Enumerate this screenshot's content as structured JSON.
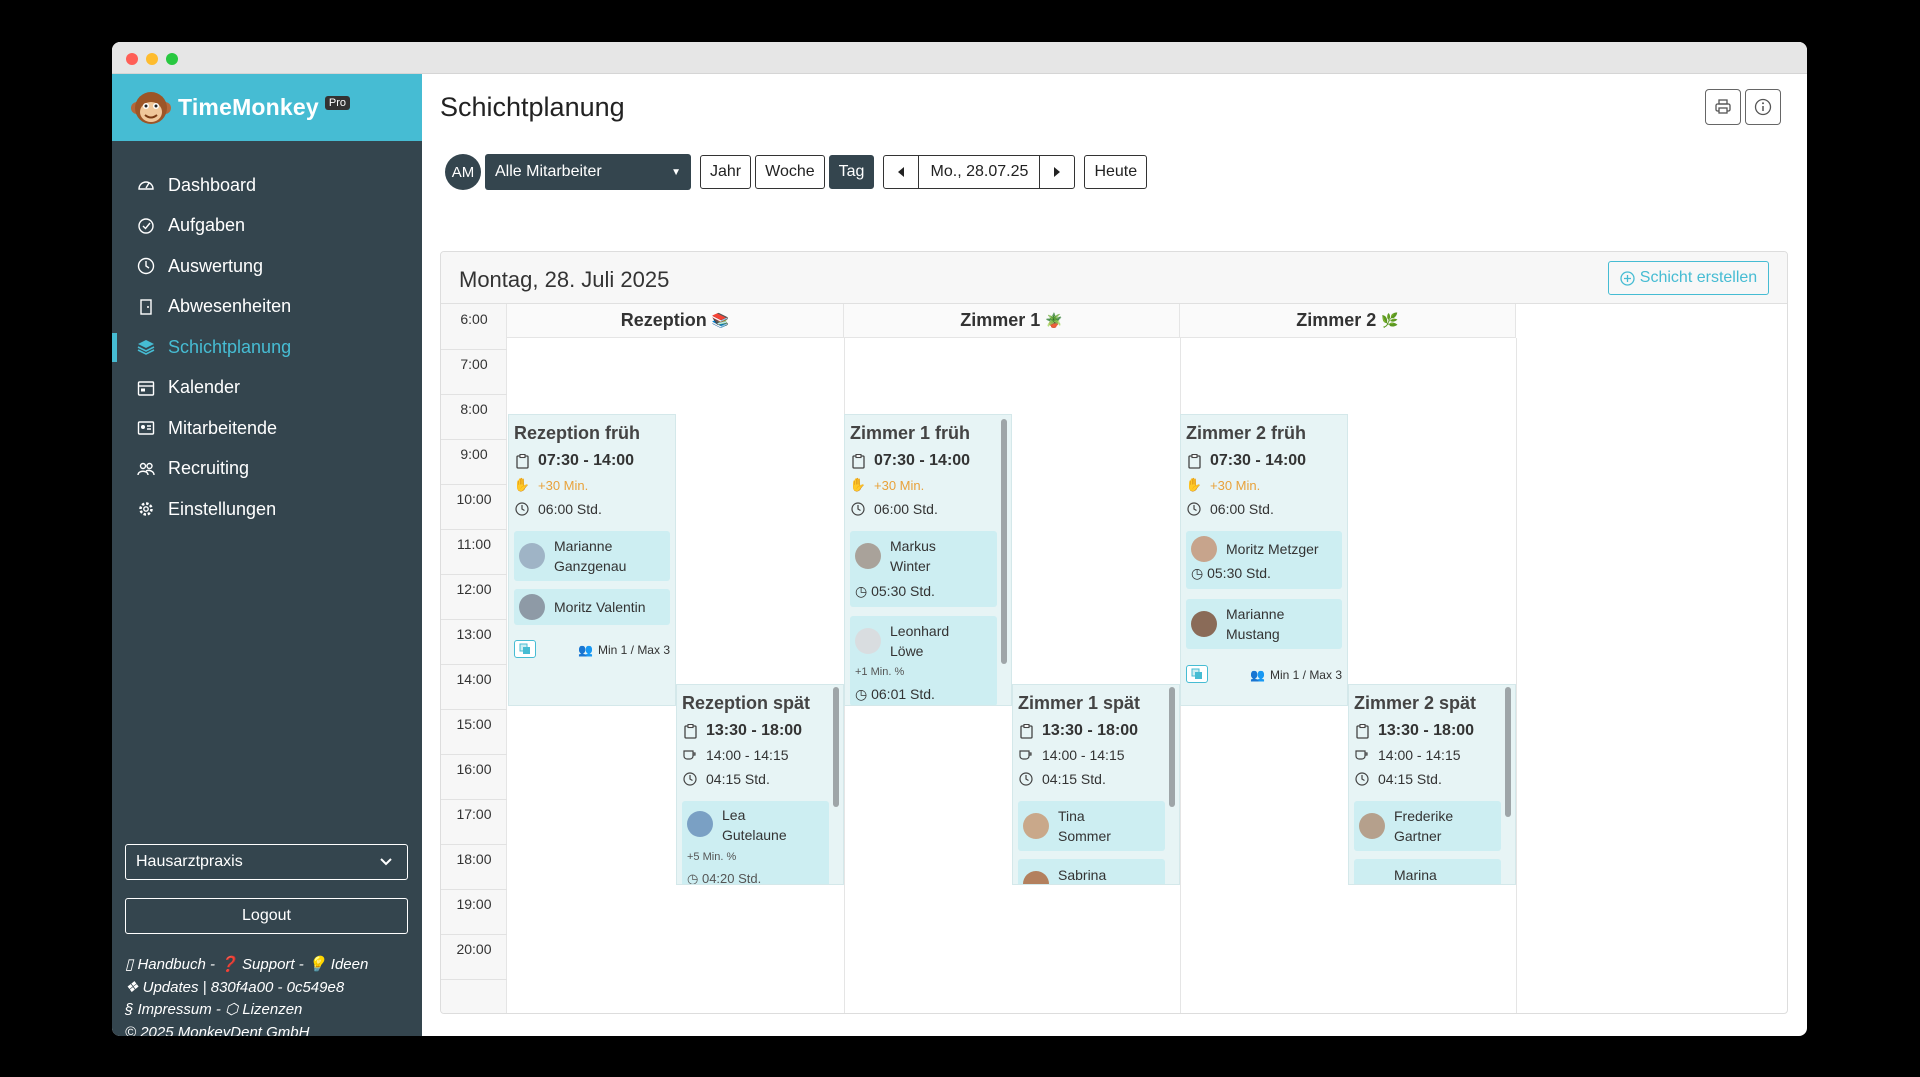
{
  "brand": {
    "name": "TimeMonkey",
    "badge": "Pro"
  },
  "nav": [
    {
      "label": "Dashboard",
      "icon": "dashboard-icon"
    },
    {
      "label": "Aufgaben",
      "icon": "check-circle-icon"
    },
    {
      "label": "Auswertung",
      "icon": "clock-icon"
    },
    {
      "label": "Abwesenheiten",
      "icon": "door-icon"
    },
    {
      "label": "Schichtplanung",
      "icon": "layers-icon",
      "active": true
    },
    {
      "label": "Kalender",
      "icon": "calendar-icon"
    },
    {
      "label": "Mitarbeitende",
      "icon": "id-card-icon"
    },
    {
      "label": "Recruiting",
      "icon": "people-icon"
    },
    {
      "label": "Einstellungen",
      "icon": "gear-icon"
    }
  ],
  "sidebar": {
    "org": "Hausarztpraxis",
    "logout": "Logout",
    "footer": {
      "handbook": "Handbuch",
      "support": "Support",
      "ideas": "Ideen",
      "updates": "Updates | 830f4a00 - 0c549e8",
      "impressum": "§ Impressum",
      "licenses": "Lizenzen",
      "copyright": "© 2025 MonkeyDent GmbH"
    }
  },
  "page": {
    "title": "Schichtplanung",
    "avatar": "AM",
    "employee_select": "Alle Mitarbeiter",
    "views": [
      "Jahr",
      "Woche",
      "Tag"
    ],
    "active_view": "Tag",
    "date": "Mo., 28.07.25",
    "today": "Heute",
    "day_title": "Montag, 28. Juli 2025",
    "create_shift": "Schicht erstellen"
  },
  "columns": [
    {
      "name": "Rezeption",
      "emoji": "📚"
    },
    {
      "name": "Zimmer 1",
      "emoji": "🪴"
    },
    {
      "name": "Zimmer 2",
      "emoji": "🌿"
    }
  ],
  "hours": [
    "6:00",
    "7:00",
    "8:00",
    "9:00",
    "10:00",
    "11:00",
    "12:00",
    "13:00",
    "14:00",
    "15:00",
    "16:00",
    "17:00",
    "18:00",
    "19:00",
    "20:00"
  ],
  "shifts": {
    "rez_frueh": {
      "title": "Rezeption früh",
      "time": "07:30 - 14:00",
      "extra": "+30 Min.",
      "hours": "06:00 Std.",
      "emp1": "Marianne Ganzgenau",
      "emp2": "Moritz Valentin",
      "minmax": "Min 1 / Max 3"
    },
    "rez_spaet": {
      "title": "Rezeption spät",
      "time": "13:30 - 18:00",
      "break": "14:00 - 14:15",
      "hours": "04:15 Std.",
      "emp1_first": "Lea",
      "emp1_last": "Gutelaune",
      "emp1_extra": "+5 Min.",
      "emp1_hours": "04:20 Std."
    },
    "z1_frueh": {
      "title": "Zimmer 1 früh",
      "time": "07:30 - 14:00",
      "extra": "+30 Min.",
      "hours": "06:00 Std.",
      "emp1_first": "Markus",
      "emp1_last": "Winter",
      "emp1_hours": "05:30 Std.",
      "emp2_first": "Leonhard",
      "emp2_last": "Löwe",
      "emp2_extra": "+1 Min.",
      "emp2_hours": "06:01 Std."
    },
    "z1_spaet": {
      "title": "Zimmer 1 spät",
      "time": "13:30 - 18:00",
      "break": "14:00 - 14:15",
      "hours": "04:15 Std.",
      "emp1_first": "Tina",
      "emp1_last": "Sommer",
      "emp2": "Sabrina"
    },
    "z2_frueh": {
      "title": "Zimmer 2 früh",
      "time": "07:30 - 14:00",
      "extra": "+30 Min.",
      "hours": "06:00 Std.",
      "emp1": "Moritz Metzger",
      "emp1_hours": "05:30 Std.",
      "emp2_first": "Marianne",
      "emp2_last": "Mustang",
      "minmax": "Min 1 / Max 3"
    },
    "z2_spaet": {
      "title": "Zimmer 2 spät",
      "time": "13:30 - 18:00",
      "break": "14:00 - 14:15",
      "hours": "04:15 Std.",
      "emp1_first": "Frederike",
      "emp1_last": "Gartner",
      "emp2": "Marina"
    }
  }
}
